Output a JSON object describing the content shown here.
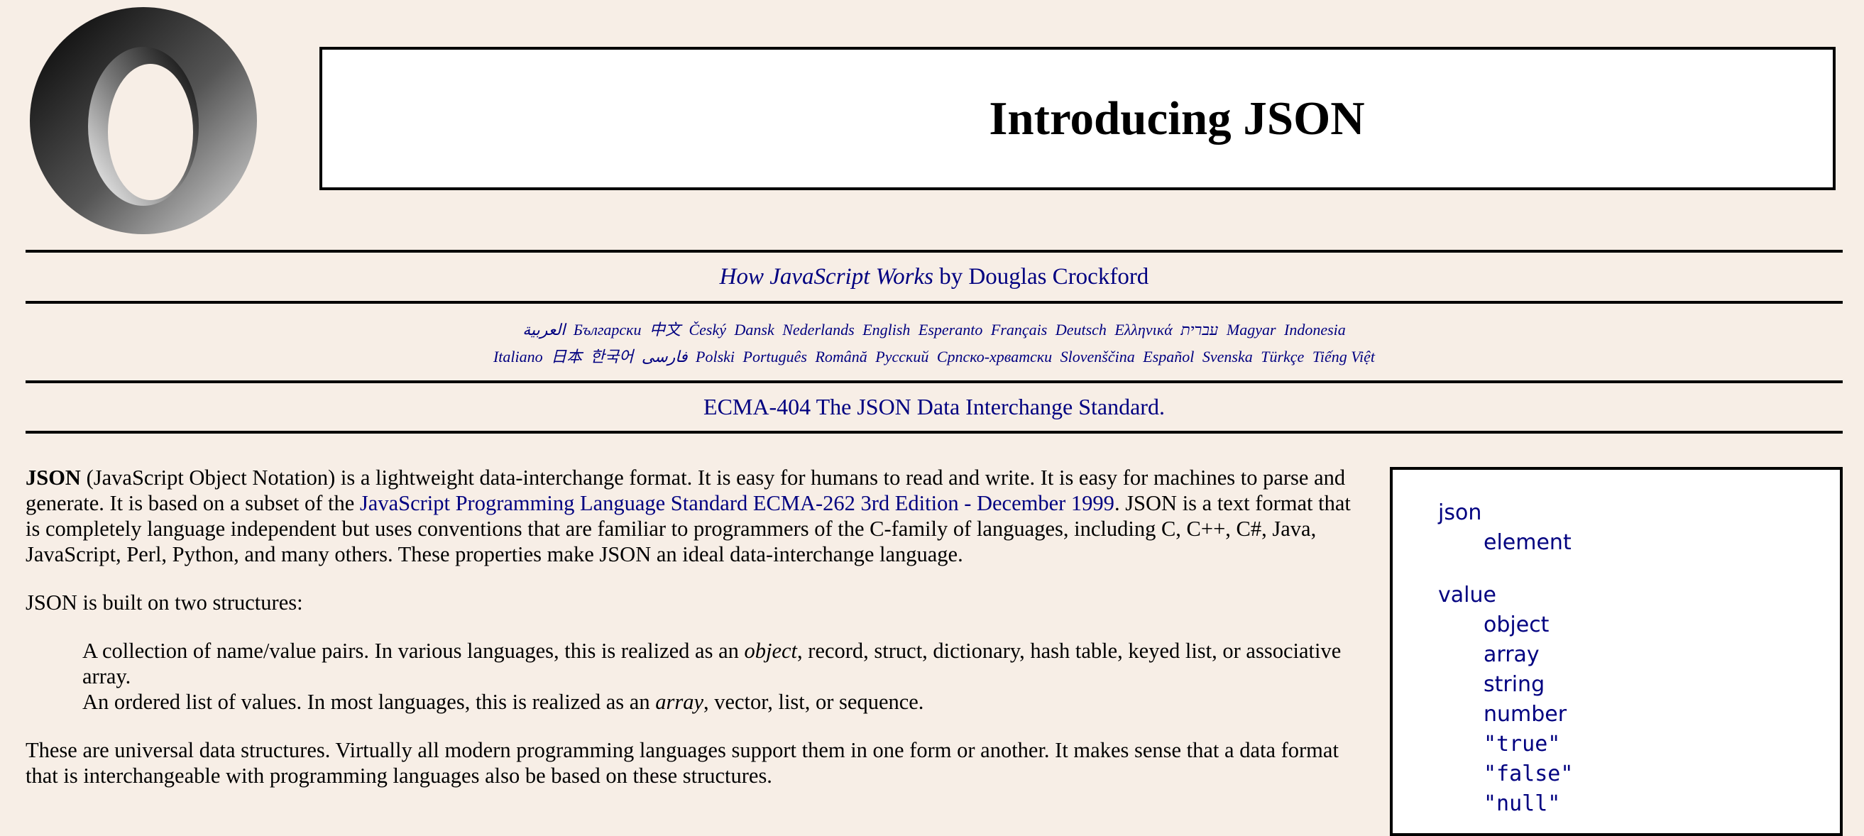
{
  "header": {
    "title": "Introducing JSON",
    "logo_icon": "json-logo-icon"
  },
  "book": {
    "title": "How JavaScript Works",
    "byline": " by Douglas Crockford"
  },
  "languages": {
    "row1": [
      "العربية",
      "Български",
      "中文",
      "Český",
      "Dansk",
      "Nederlands",
      "English",
      "Esperanto",
      "Français",
      "Deutsch",
      "Ελληνικά",
      "עברית",
      "Magyar",
      "Indonesia"
    ],
    "row2": [
      "Italiano",
      "日本",
      "한국어",
      "فارسی",
      "Polski",
      "Português",
      "Română",
      "Русский",
      "Српско-хрватски",
      "Slovenščina",
      "Español",
      "Svenska",
      "Türkçe",
      "Tiếng Việt"
    ]
  },
  "ecma_link": "ECMA-404 The JSON Data Interchange Standard.",
  "intro": {
    "bold": "JSON",
    "part1": " (JavaScript Object Notation) is a lightweight data-interchange format. It is easy for humans to read and write. It is easy for machines to parse and generate. It is based on a subset of the ",
    "link": "JavaScript Programming Language Standard ECMA-262 3rd Edition - December 1999",
    "part2": ". JSON is a text format that is completely language independent but uses conventions that are familiar to programmers of the C-family of languages, including C, C++, C#, Java, JavaScript, Perl, Python, and many others. These properties make JSON an ideal data-interchange language."
  },
  "structures_intro": "JSON is built on two structures:",
  "structures": {
    "item1_a": "A collection of name/value pairs. In various languages, this is realized as an ",
    "item1_em": "object",
    "item1_b": ", record, struct, dictionary, hash table, keyed list, or associative array.",
    "item2_a": "An ordered list of values. In most languages, this is realized as an ",
    "item2_em": "array",
    "item2_b": ", vector, list, or sequence."
  },
  "universal": "These are universal data structures. Virtually all modern programming languages support them in one form or another. It makes sense that a data format that is interchangeable with programming languages also be based on these structures.",
  "grammar": {
    "json": {
      "name": "json",
      "alts": [
        "element"
      ]
    },
    "value": {
      "name": "value",
      "alts": [
        "object",
        "array",
        "string",
        "number",
        "\"true\"",
        "\"false\"",
        "\"null\""
      ]
    }
  },
  "colors": {
    "background": "#f7eee6",
    "link": "#000080"
  }
}
